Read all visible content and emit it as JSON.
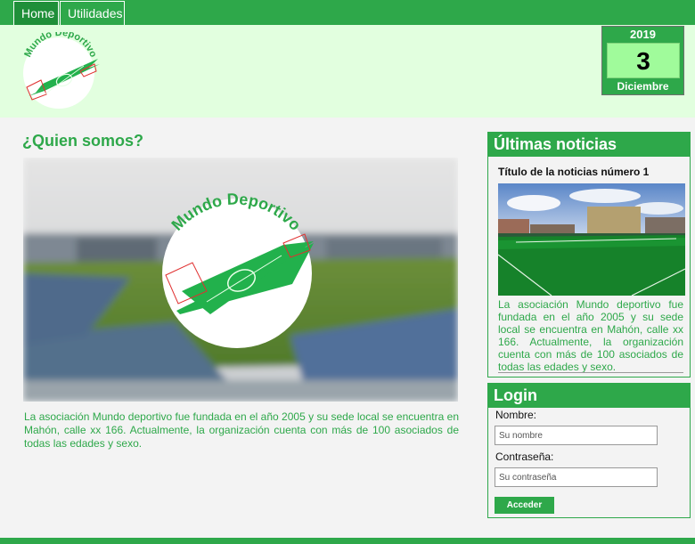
{
  "nav": {
    "items": [
      {
        "label": "Home",
        "active": true
      },
      {
        "label": "Utilidades",
        "active": false
      }
    ]
  },
  "header": {
    "logo_text": "Mundo Deportivo",
    "date": {
      "year": "2019",
      "day": "3",
      "month": "Diciembre"
    }
  },
  "main": {
    "title": "¿Quien somos?",
    "hero_logo_text": "Mundo Deportivo",
    "text": "La asociación Mundo deportivo fue fundada en el año 2005 y su sede local se encuentra en Mahón, calle xx 166. Actualmente, la organización cuenta con más de 100 asociados de todas las edades y sexo."
  },
  "news": {
    "heading": "Últimas noticias",
    "title": "Título de la noticias número 1",
    "text": "La asociación Mundo deportivo fue fundada en el año 2005 y su sede local se encuentra en Mahón, calle xx 166. Actualmente, la organización cuenta con más de 100 asociados de todas las edades y sexo."
  },
  "login": {
    "heading": "Login",
    "name_label": "Nombre:",
    "name_placeholder": "Su nombre",
    "password_label": "Contraseña:",
    "password_placeholder": "Su contraseña",
    "submit_label": "Acceder"
  },
  "colors": {
    "brand_green": "#2ea84a",
    "header_bg": "#e2ffdf",
    "date_day_bg": "#a0fb9b"
  }
}
